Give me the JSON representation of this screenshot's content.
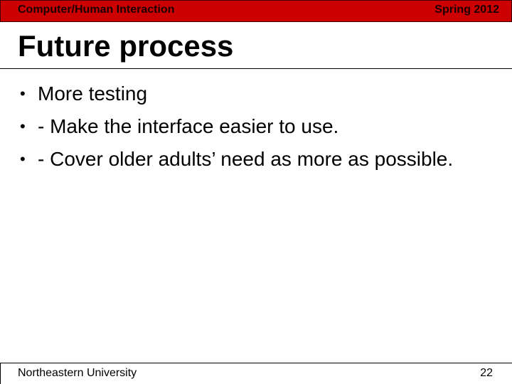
{
  "header": {
    "course": "Computer/Human Interaction",
    "term": "Spring 2012",
    "bar_color": "#cc0000"
  },
  "slide": {
    "title": "Future process",
    "bullets": [
      {
        "marker": "•",
        "text": "More testing"
      },
      {
        "marker": "•",
        "text": "- Make the interface easier to use."
      },
      {
        "marker": "•",
        "text": "- Cover older adults’ need as more as possible."
      }
    ]
  },
  "footer": {
    "institution": "Northeastern University",
    "page_number": "22"
  }
}
